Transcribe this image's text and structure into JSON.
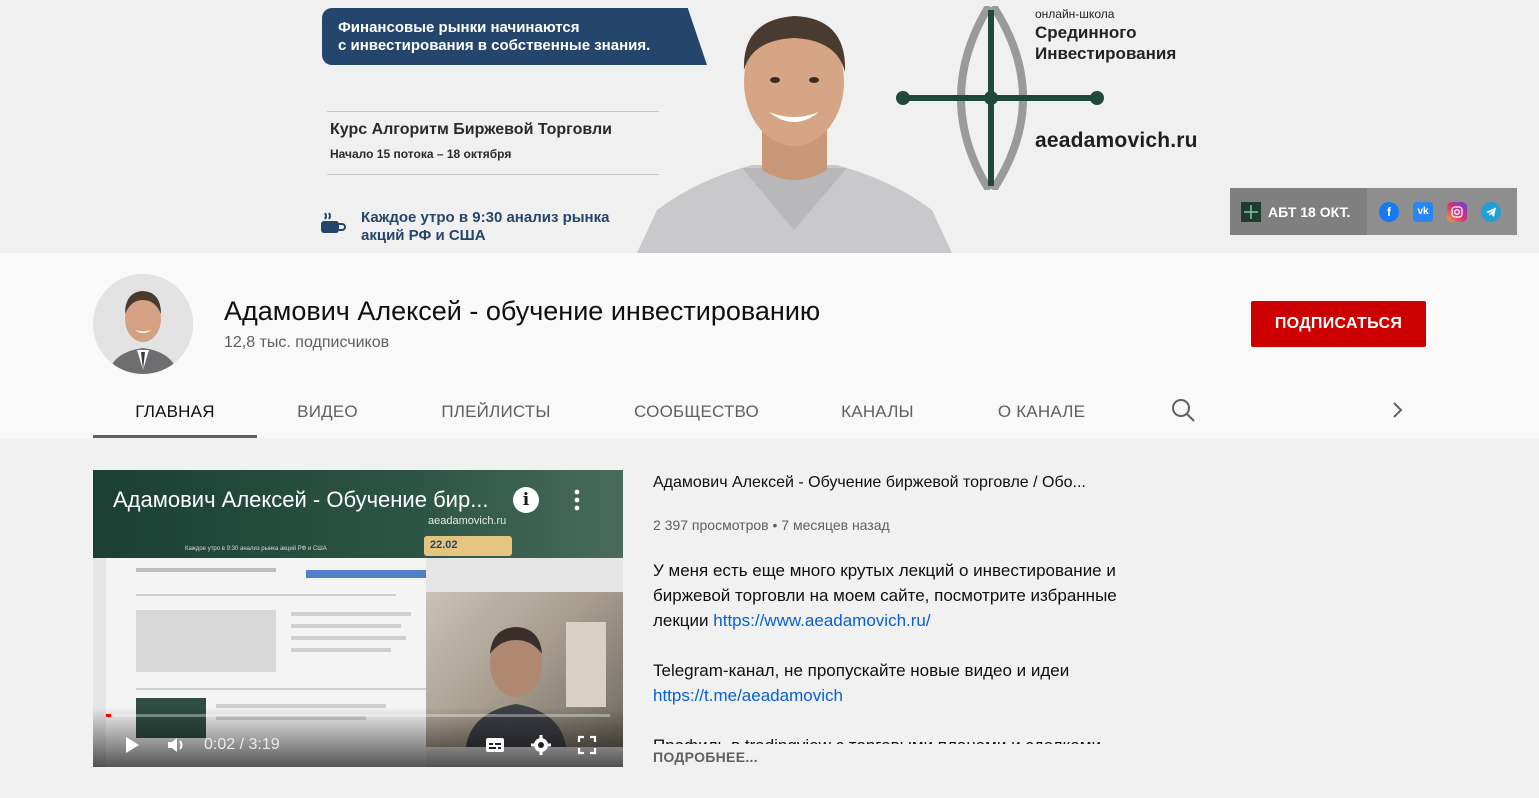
{
  "banner": {
    "tagline_line1": "Финансовые рынки начинаются",
    "tagline_line2": "с инвестирования в собственные знания.",
    "course_title": "Курс Алгоритм Биржевой Торговли",
    "course_start": "Начало 15 потока – 18 октября",
    "daily_line1": "Каждое утро в 9:30 анализ рынка",
    "daily_line2": "акций РФ и США",
    "school_small": "онлайн-школа",
    "school_line1": "Срединного",
    "school_line2": "Инвестирования",
    "site": "aeadamovich.ru",
    "link_label": "АБТ 18 ОКТ.",
    "social_icons": [
      "facebook-icon",
      "vk-icon",
      "instagram-icon",
      "telegram-icon"
    ],
    "colors": {
      "navy": "#25466c",
      "logo_green": "#1f4a3a",
      "logo_grey": "#9a9a9a"
    }
  },
  "channel": {
    "name": "Адамович Алексей - обучение инвестированию",
    "subscribers": "12,8 тыс. подписчиков",
    "subscribe_label": "ПОДПИСАТЬСЯ",
    "subscribe_color": "#cc0000"
  },
  "tabs": [
    {
      "label": "ГЛАВНАЯ",
      "active": true
    },
    {
      "label": "ВИДЕО",
      "active": false
    },
    {
      "label": "ПЛЕЙЛИСТЫ",
      "active": false
    },
    {
      "label": "СООБЩЕСТВО",
      "active": false
    },
    {
      "label": "КАНАЛЫ",
      "active": false
    },
    {
      "label": "О КАНАЛЕ",
      "active": false
    }
  ],
  "player": {
    "title": "Адамович Алексей - Обучение бир...",
    "overlay_site": "aeadamovich.ru",
    "overlay_date": "22.02",
    "overlay_caption": "Каждое утро в 9:30 анализ рынка акций РФ и США",
    "time": "0:02 / 3:19",
    "progress": 0.01
  },
  "featured": {
    "title": "Адамович Алексей - Обучение биржевой торговле  / Обо...",
    "views": "2 397 просмотров",
    "age": "7 месяцев назад",
    "desc_line1": "У меня есть еще много крутых лекций о инвестирование и биржевой торговли на моем сайте, посмотрите избранные лекции ",
    "desc_link1": "https://www.aeadamovich.ru/",
    "desc_line2": "Telegram-канал, не пропускайте новые видео и идеи",
    "desc_link2": "https://t.me/aeadamovich",
    "desc_line3": "Профиль в tradingview с торговыми планами и сделками",
    "more_label": "ПОДРОБНЕЕ..."
  }
}
